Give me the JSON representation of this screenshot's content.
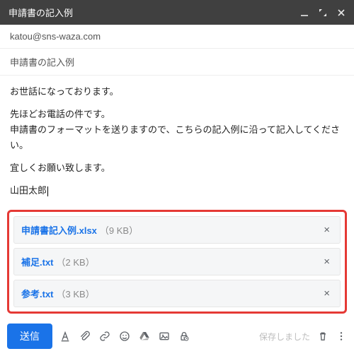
{
  "window": {
    "title": "申請書の記入例"
  },
  "recipients": "katou@sns-waza.com",
  "subject": "申請書の記入例",
  "body": {
    "greeting": "お世話になっております。",
    "line1": "先ほどお電話の件です。",
    "line2": "申請書のフォーマットを送りますので、こちらの記入例に沿って記入してください。",
    "closing": "宜しくお願い致します。",
    "signature": "山田太郎"
  },
  "attachments": [
    {
      "name": "申請書記入例.xlsx",
      "size": "（9 KB）"
    },
    {
      "name": "補足.txt",
      "size": "（2 KB）"
    },
    {
      "name": "参考.txt",
      "size": "（3 KB）"
    }
  ],
  "actions": {
    "send": "送信",
    "saved": "保存しました"
  }
}
